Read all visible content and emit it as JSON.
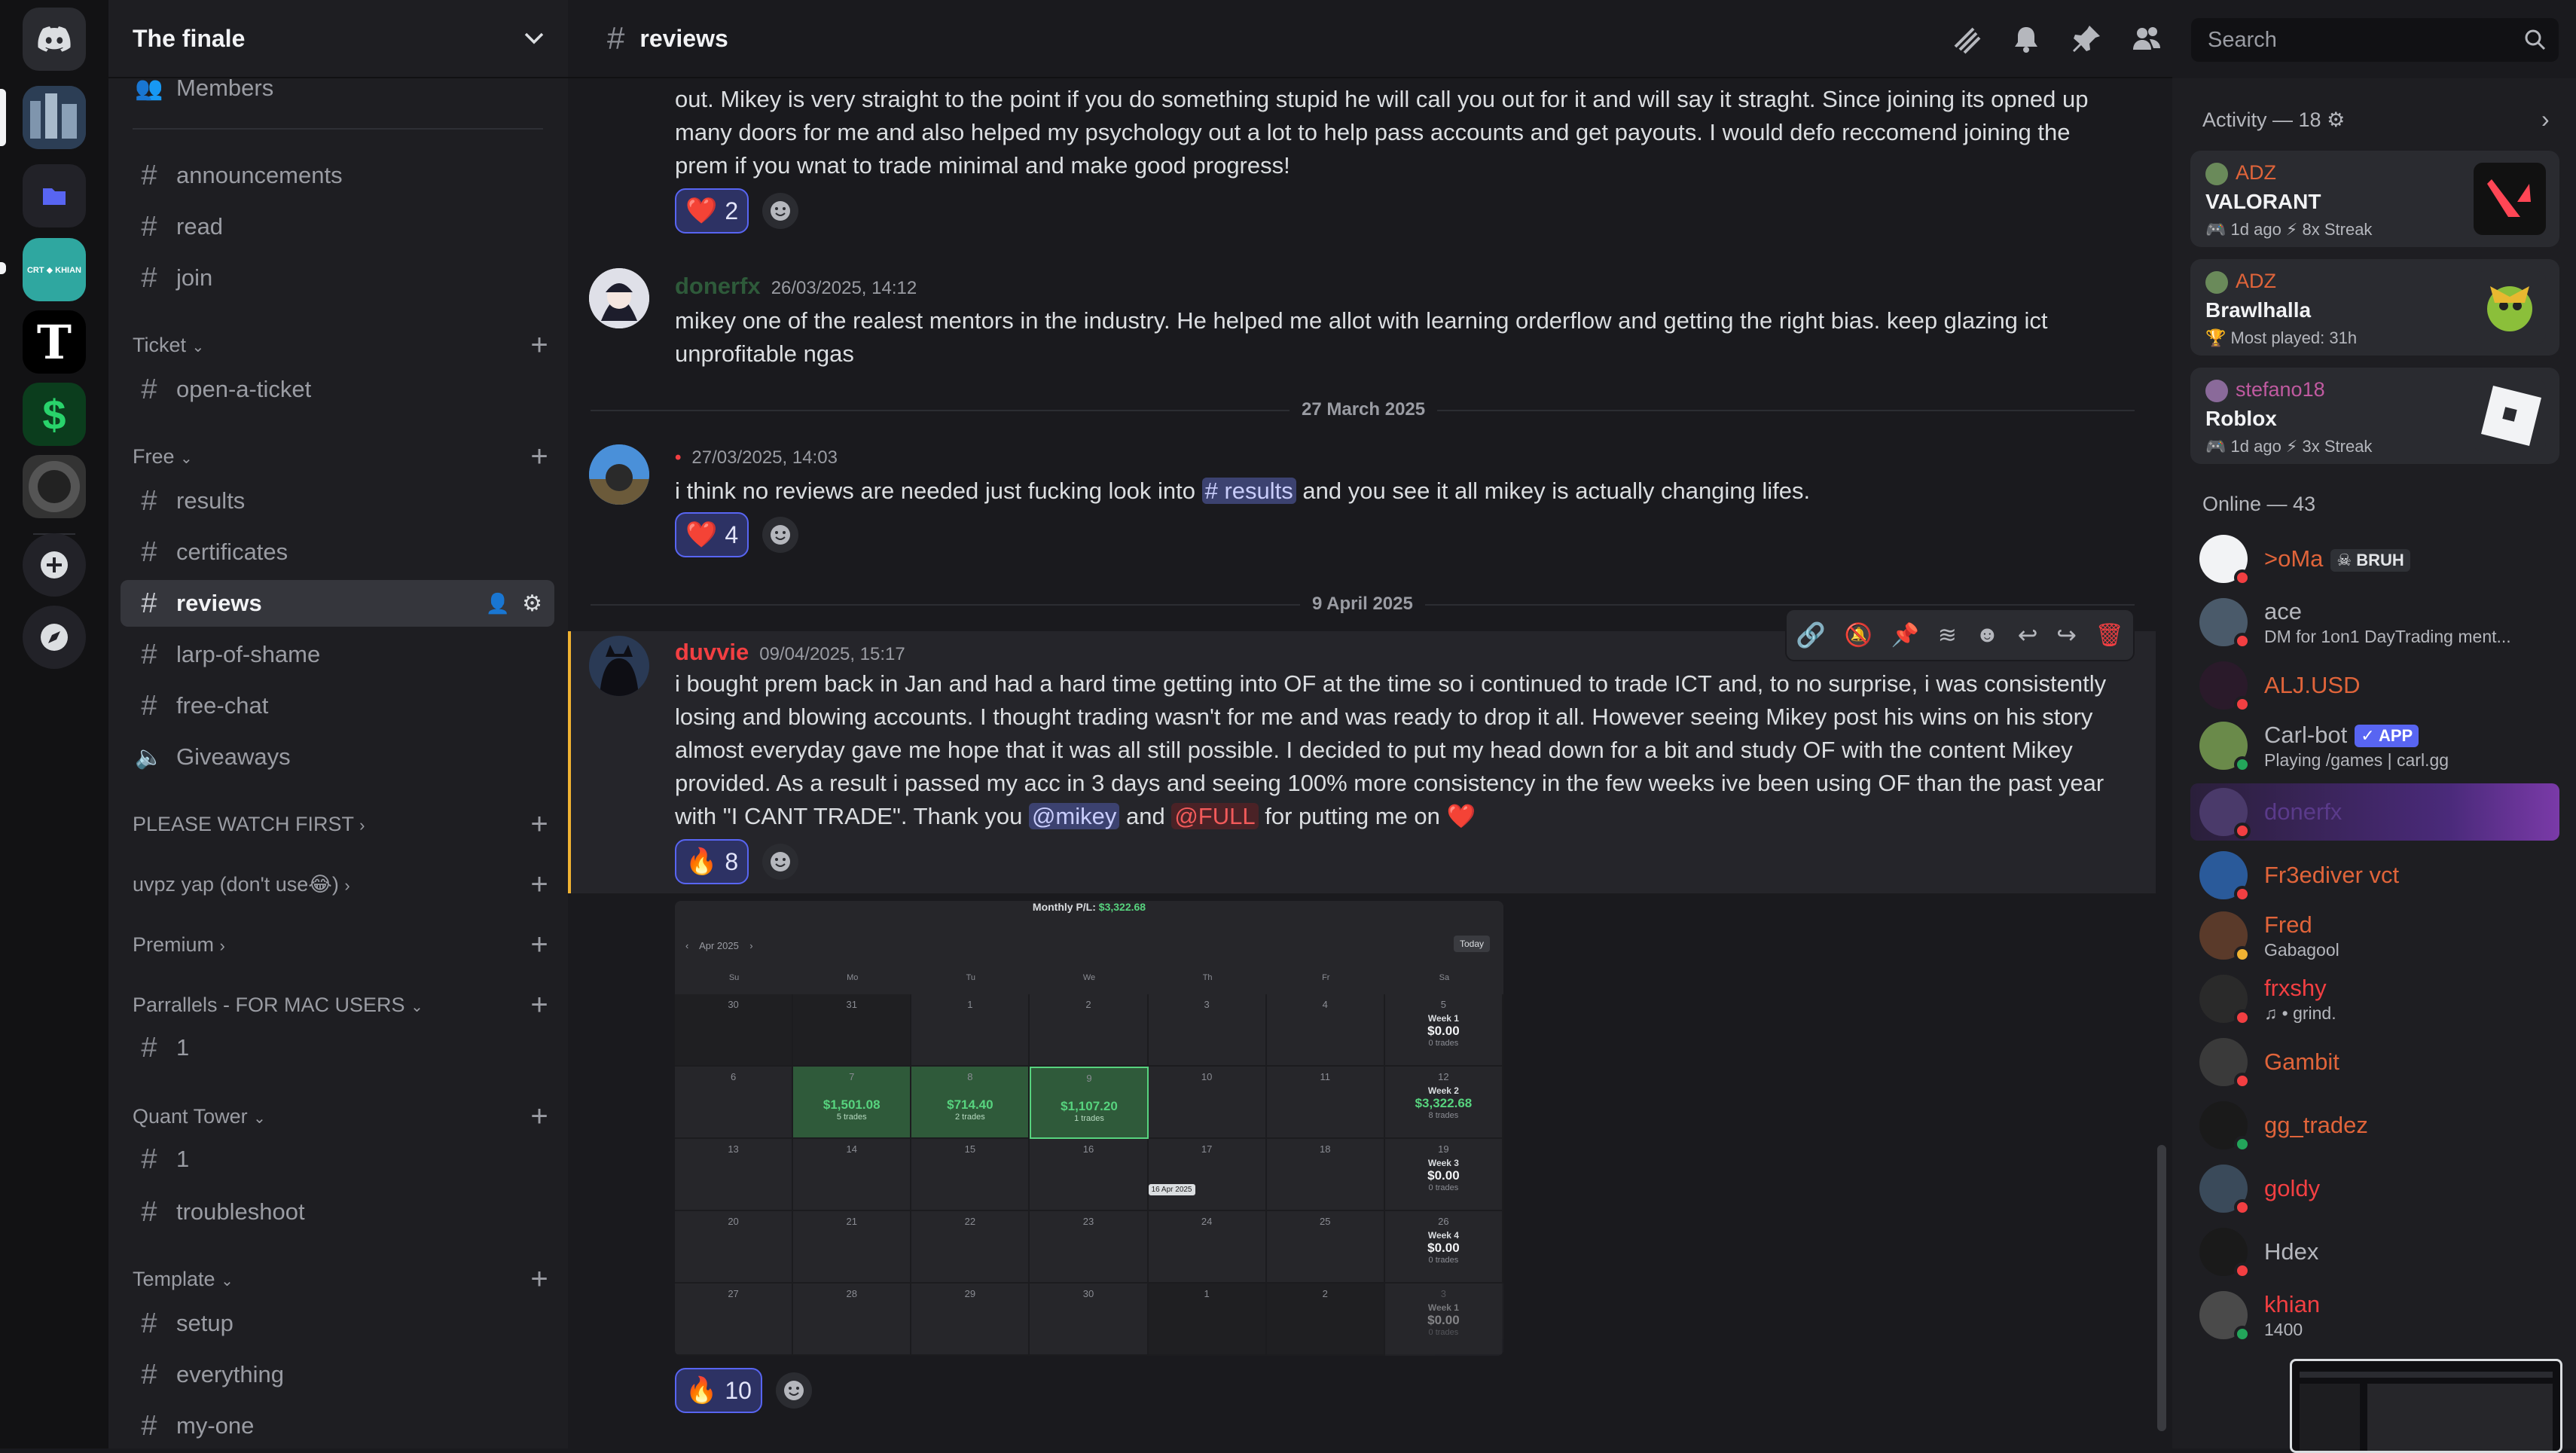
{
  "server": {
    "name": "The finale"
  },
  "sidebar": {
    "members_label": "Members",
    "channels_top": [
      "announcements",
      "read",
      "join"
    ],
    "categories": [
      {
        "label": "Ticket",
        "channels": [
          "open-a-ticket"
        ]
      },
      {
        "label": "Free",
        "channels": [
          "results",
          "certificates",
          "reviews",
          "larp-of-shame",
          "free-chat",
          "Giveaways"
        ]
      },
      {
        "label": "PLEASE WATCH FIRST"
      },
      {
        "label": "uvpz yap (don't use😂)"
      },
      {
        "label": "Premium"
      },
      {
        "label": "Parrallels - FOR MAC USERS",
        "channels": [
          "1"
        ]
      },
      {
        "label": "Quant Tower",
        "channels": [
          "1",
          "troubleshoot"
        ]
      },
      {
        "label": "Template",
        "channels": [
          "setup",
          "everything",
          "my-one"
        ]
      }
    ],
    "rail_server_label": "CRT ◆ KHIAN"
  },
  "channel": {
    "name": "reviews",
    "search_placeholder": "Search"
  },
  "messages": [
    {
      "text": "out. Mikey is very straight to the point if you do something stupid he will call you out for it and will say it straght. Since joining its opned up many doors for me and also helped my psychology out a lot to help pass accounts and get payouts. I would defo reccomend joining the prem if you wnat to trade minimal and make good progress!",
      "reaction": {
        "emoji": "❤️",
        "count": "2"
      }
    },
    {
      "author": "donerfx",
      "author_color": "#2e5a3a",
      "timestamp": "26/03/2025, 14:12",
      "text": "mikey one of the realest mentors in the industry. He helped me allot with learning orderflow and getting the right bias. keep glazing ict unprofitable ngas"
    },
    {
      "date_divider": "27 March 2025",
      "author": "•",
      "timestamp": "27/03/2025, 14:03",
      "text_before": "i think no reviews are needed just fucking look into ",
      "channel_mention": "# results",
      "text_after": " and you see it all mikey is actually changing lifes.",
      "reaction": {
        "emoji": "❤️",
        "count": "4"
      }
    },
    {
      "date_divider": "9 April 2025",
      "author": "duvvie",
      "author_color": "#f23f42",
      "timestamp": "09/04/2025, 15:17",
      "text": "i bought prem back in Jan and had a hard time getting into OF at the time so i continued to trade ICT and, to no surprise, i was consistently losing and blowing accounts. I thought trading wasn't for me and was ready to drop it all. However seeing Mikey post his wins on his story almost everyday gave me hope that it was all still possible. I decided to put my head down for a bit and study OF with the content Mikey provided. As a result i passed my acc in 3 days and seeing 100% more consistency in the few weeks ive been using OF than the past year with \"I CANT TRADE\". Thank you ",
      "mention1": "@mikey",
      "between": " and ",
      "mention2": "@FULL",
      "text_end": " for putting me on ",
      "end_emoji": "❤️",
      "reaction": {
        "emoji": "🔥",
        "count": "8"
      },
      "image_reaction": {
        "emoji": "🔥",
        "count": "10"
      }
    }
  ],
  "calendar": {
    "title_prefix": "Monthly P/L:",
    "title_value": "$3,322.68",
    "month": "Apr 2025",
    "today": "Today",
    "weekdays": [
      "Su",
      "Mo",
      "Tu",
      "We",
      "Th",
      "Fr",
      "Sa"
    ],
    "tooltip": "16 Apr 2025",
    "rows": [
      {
        "days": [
          "30",
          "31",
          "1",
          "2",
          "3",
          "4"
        ],
        "week": {
          "label": "Week 1",
          "day": "5",
          "amount": "$0.00",
          "trades": "0 trades"
        }
      },
      {
        "days": [
          "6",
          "7",
          "8",
          "9",
          "10",
          "11"
        ],
        "week": {
          "label": "Week 2",
          "day": "12",
          "amount": "$3,322.68",
          "trades": "8 trades"
        }
      },
      {
        "days": [
          "13",
          "14",
          "15",
          "16",
          "17",
          "18"
        ],
        "week": {
          "label": "Week 3",
          "day": "19",
          "amount": "$0.00",
          "trades": "0 trades"
        }
      },
      {
        "days": [
          "20",
          "21",
          "22",
          "23",
          "24",
          "25"
        ],
        "week": {
          "label": "Week 4",
          "day": "26",
          "amount": "$0.00",
          "trades": "0 trades"
        }
      },
      {
        "days": [
          "27",
          "28",
          "29",
          "30",
          "1",
          "2"
        ],
        "week": {
          "label": "Week 1",
          "day": "3",
          "amount": "$0.00",
          "trades": "0 trades"
        }
      }
    ],
    "trading_days": [
      {
        "amount": "$1,501.08",
        "trades": "5 trades"
      },
      {
        "amount": "$714.40",
        "trades": "2 trades"
      },
      {
        "amount": "$1,107.20",
        "trades": "1 trades"
      }
    ]
  },
  "members_panel": {
    "activity_header": "Activity — 18",
    "activities": [
      {
        "user": "ADZ",
        "game": "VALORANT",
        "meta": "1d ago  ⚡ 8x Streak"
      },
      {
        "user": "ADZ",
        "game": "Brawlhalla",
        "meta": "Most played: 31h"
      },
      {
        "user": "stefano18",
        "game": "Roblox",
        "meta": "1d ago  ⚡ 3x Streak"
      }
    ],
    "online_header": "Online — 43",
    "online": [
      {
        "name": ">oMa",
        "tag": "BRUH",
        "color": "#e0643a",
        "status": "#f23f42"
      },
      {
        "name": "ace",
        "sub": "DM for 1on1 DayTrading ment...",
        "color": "#b5b7bd",
        "status": "#f23f42"
      },
      {
        "name": "ALJ.USD",
        "color": "#e0643a",
        "status": "#f23f42"
      },
      {
        "name": "Carl-bot",
        "tag": "APP",
        "sub": "Playing /games | carl.gg",
        "color": "#b5b7bd",
        "status": "#23a55a"
      },
      {
        "name": "donerfx",
        "color": "#5a3a8a",
        "status": "#f23f42"
      },
      {
        "name": "Fr3ediver vct",
        "color": "#e0643a",
        "status": "#f23f42"
      },
      {
        "name": "Fred",
        "sub": "Gabagool",
        "color": "#e0643a",
        "status": "#f0b232"
      },
      {
        "name": "frxshy",
        "sub": "♫ • grind.",
        "color": "#f23f42",
        "status": "#f23f42"
      },
      {
        "name": "Gambit",
        "color": "#e0643a",
        "status": "#f23f42"
      },
      {
        "name": "gg_tradez",
        "color": "#e0643a",
        "status": "#23a55a"
      },
      {
        "name": "goldy",
        "color": "#f23f42",
        "status": "#f23f42"
      },
      {
        "name": "Hdex",
        "color": "#b5b7bd",
        "status": "#f23f42"
      },
      {
        "name": "khian",
        "sub": "1400",
        "color": "#f23f42",
        "status": "#23a55a"
      }
    ]
  }
}
